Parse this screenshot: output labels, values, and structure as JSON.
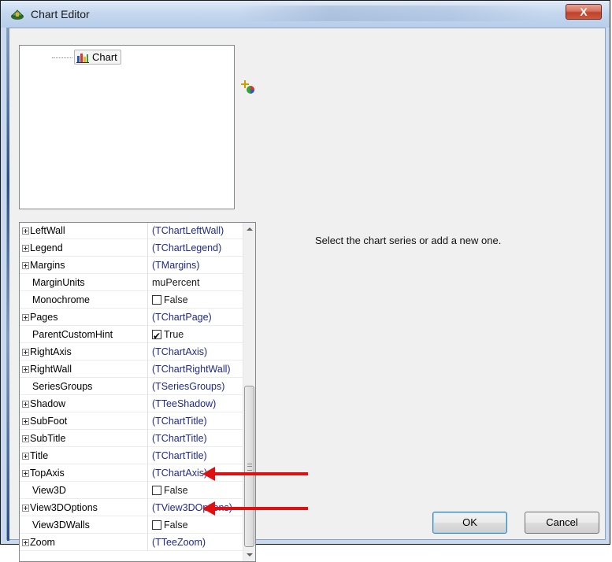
{
  "window": {
    "title": "Chart Editor",
    "close_label": "X"
  },
  "tree": {
    "root_label": "Chart"
  },
  "grid": {
    "rows": [
      {
        "expand": true,
        "name": "LeftWall",
        "value": "(TChartLeftWall)"
      },
      {
        "expand": true,
        "name": "Legend",
        "value": "(TChartLegend)"
      },
      {
        "expand": true,
        "name": "Margins",
        "value": "(TMargins)"
      },
      {
        "expand": false,
        "name": "MarginUnits",
        "value": "muPercent"
      },
      {
        "expand": false,
        "name": "Monochrome",
        "value": "False",
        "checkbox": true,
        "checked": false
      },
      {
        "expand": true,
        "name": "Pages",
        "value": "(TChartPage)"
      },
      {
        "expand": false,
        "name": "ParentCustomHint",
        "value": "True",
        "checkbox": true,
        "checked": true
      },
      {
        "expand": true,
        "name": "RightAxis",
        "value": "(TChartAxis)"
      },
      {
        "expand": true,
        "name": "RightWall",
        "value": "(TChartRightWall)"
      },
      {
        "expand": false,
        "name": "SeriesGroups",
        "value": "(TSeriesGroups)"
      },
      {
        "expand": true,
        "name": "Shadow",
        "value": "(TTeeShadow)"
      },
      {
        "expand": true,
        "name": "SubFoot",
        "value": "(TChartTitle)"
      },
      {
        "expand": true,
        "name": "SubTitle",
        "value": "(TChartTitle)"
      },
      {
        "expand": true,
        "name": "Title",
        "value": "(TChartTitle)"
      },
      {
        "expand": true,
        "name": "TopAxis",
        "value": "(TChartAxis)"
      },
      {
        "expand": false,
        "name": "View3D",
        "value": "False",
        "checkbox": true,
        "checked": false
      },
      {
        "expand": true,
        "name": "View3DOptions",
        "value": "(TView3DOptions)"
      },
      {
        "expand": false,
        "name": "View3DWalls",
        "value": "False",
        "checkbox": true,
        "checked": false
      },
      {
        "expand": true,
        "name": "Zoom",
        "value": "(TTeeZoom)"
      }
    ]
  },
  "message": "Select the chart series or add a new one.",
  "buttons": {
    "ok": "OK",
    "cancel": "Cancel"
  },
  "colors": {
    "arrow": "#e01010",
    "value_text": "#1f2a8a"
  }
}
